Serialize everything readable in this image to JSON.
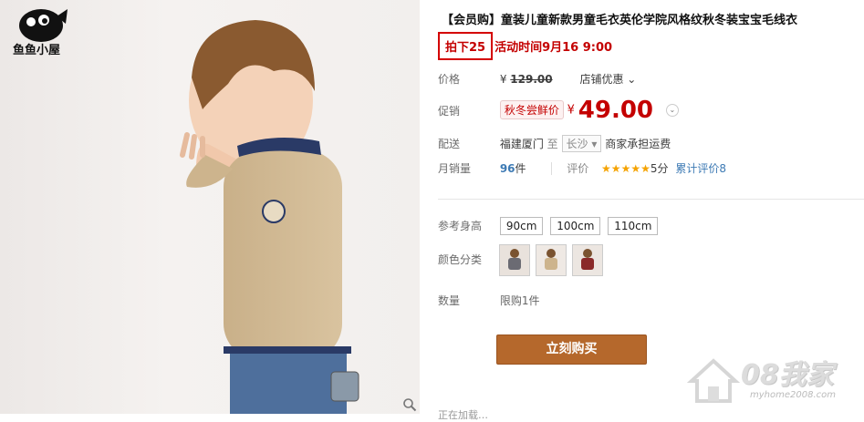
{
  "logo": {
    "text": "鱼鱼小屋"
  },
  "product": {
    "title": "【会员购】童装儿童新款男童毛衣英伦学院风格纹秋冬装宝宝毛线衣",
    "promo_highlight": "拍下25",
    "promo_rest": "活动时间9月16 9:00"
  },
  "price_row": {
    "label": "价格",
    "currency": "¥",
    "original": "129.00",
    "dropdown": "店铺优惠"
  },
  "promo_row": {
    "label": "促销",
    "tag": "秋冬尝鲜价",
    "currency": "¥",
    "price": "49.00"
  },
  "shipping": {
    "label": "配送",
    "from": "福建厦门",
    "to_word": "至",
    "dest": "长沙",
    "note": "商家承担运费"
  },
  "sales": {
    "label": "月销量",
    "count": "96",
    "unit": "件",
    "rating_label": "评价",
    "stars": "★★★★★",
    "score": "5分",
    "review_text": "累计评价8"
  },
  "sizes": {
    "label": "参考身高",
    "options": [
      "90cm",
      "100cm",
      "110cm"
    ]
  },
  "colors": {
    "label": "颜色分类"
  },
  "quantity": {
    "label": "数量",
    "limit": "限购1件"
  },
  "buy_button": "立刻购买",
  "bottom_hint": "正在加载…",
  "watermark": {
    "text": "08我家",
    "url": "myhome2008.com"
  }
}
